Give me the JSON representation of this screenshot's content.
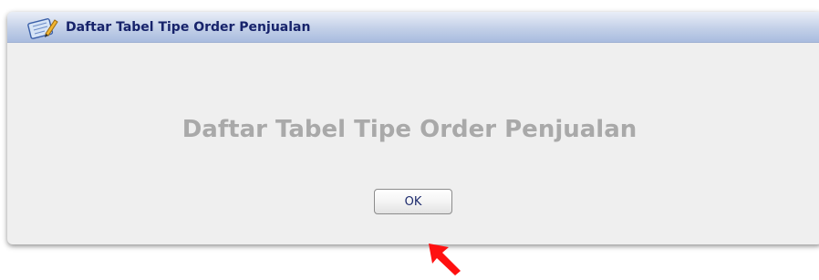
{
  "dialog": {
    "title": "Daftar Tabel Tipe Order Penjualan",
    "message": "Daftar Tabel Tipe Order Penjualan",
    "ok_label": "OK",
    "title_icon": "notepad-pencil-icon"
  },
  "annotation": {
    "icon": "red-arrow-icon",
    "color": "#ff1010"
  },
  "colors": {
    "title_text": "#17236b",
    "message_text": "#a9a9a9",
    "dialog_background": "#efefef"
  }
}
